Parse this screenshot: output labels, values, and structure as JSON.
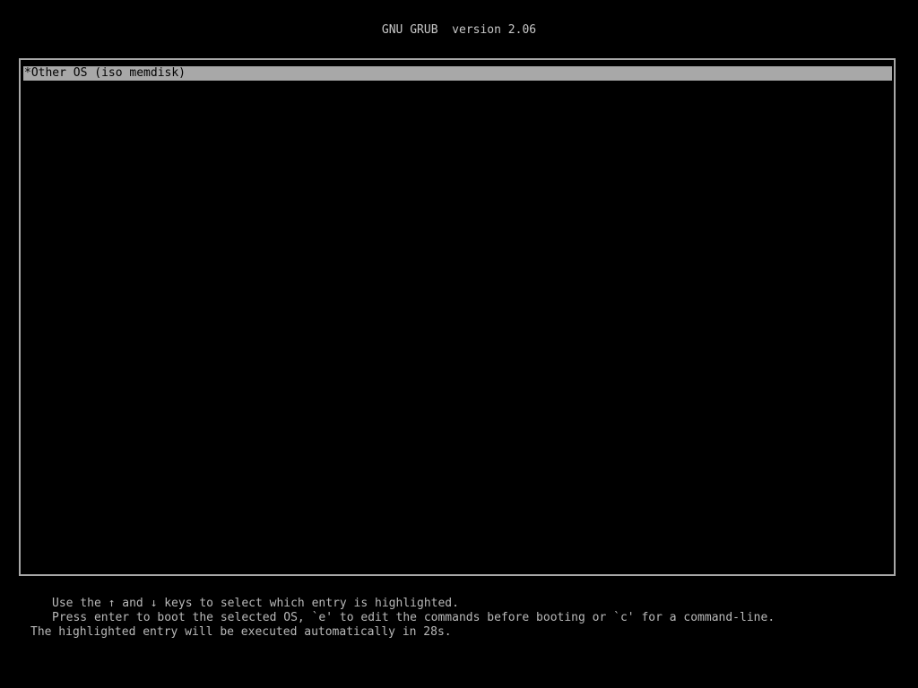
{
  "header": {
    "title": "GNU GRUB  version 2.06"
  },
  "menu": {
    "selected_index": 0,
    "entries": [
      {
        "label": "*Other OS (iso memdisk)",
        "selected": true
      }
    ]
  },
  "footer": {
    "line1": "Use the ↑ and ↓ keys to select which entry is highlighted.",
    "line2": "Press enter to boot the selected OS, `e' to edit the commands before booting or `c' for a command-line.",
    "line3": "The highlighted entry will be executed automatically in 28s."
  },
  "colors": {
    "background": "#000000",
    "text": "#b9b9b9",
    "frame": "#a8a8a8",
    "highlight_bg": "#a8a8a8",
    "highlight_text": "#000000"
  }
}
